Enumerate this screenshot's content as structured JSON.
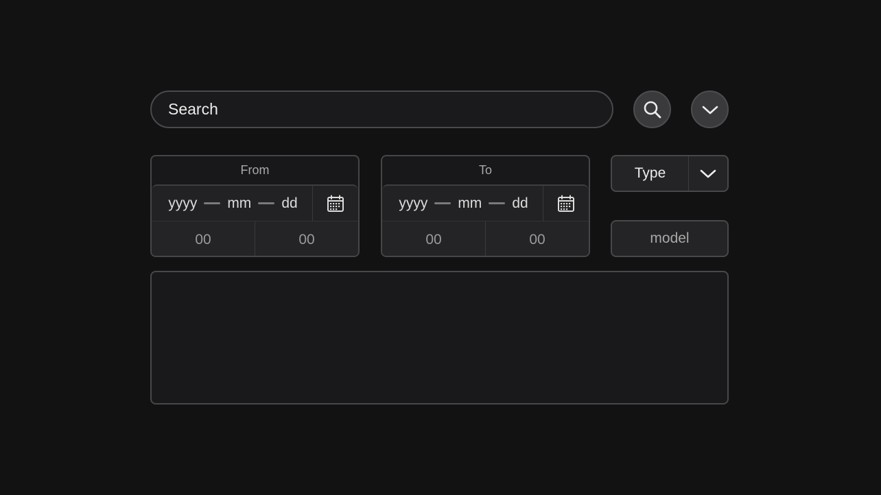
{
  "search": {
    "placeholder": "Search"
  },
  "buttons": {
    "search_icon": "search-icon",
    "expand_icon": "chevron-down-icon"
  },
  "date_from": {
    "title": "From",
    "year": "yyyy",
    "month": "mm",
    "day": "dd",
    "hour": "00",
    "minute": "00"
  },
  "date_to": {
    "title": "To",
    "year": "yyyy",
    "month": "mm",
    "day": "dd",
    "hour": "00",
    "minute": "00"
  },
  "type_select": {
    "label": "Type"
  },
  "model_button": {
    "label": "model"
  },
  "colors": {
    "background": "#121213",
    "border": "#48484b",
    "text": "#ececec",
    "muted_text": "#a8a8a8"
  }
}
